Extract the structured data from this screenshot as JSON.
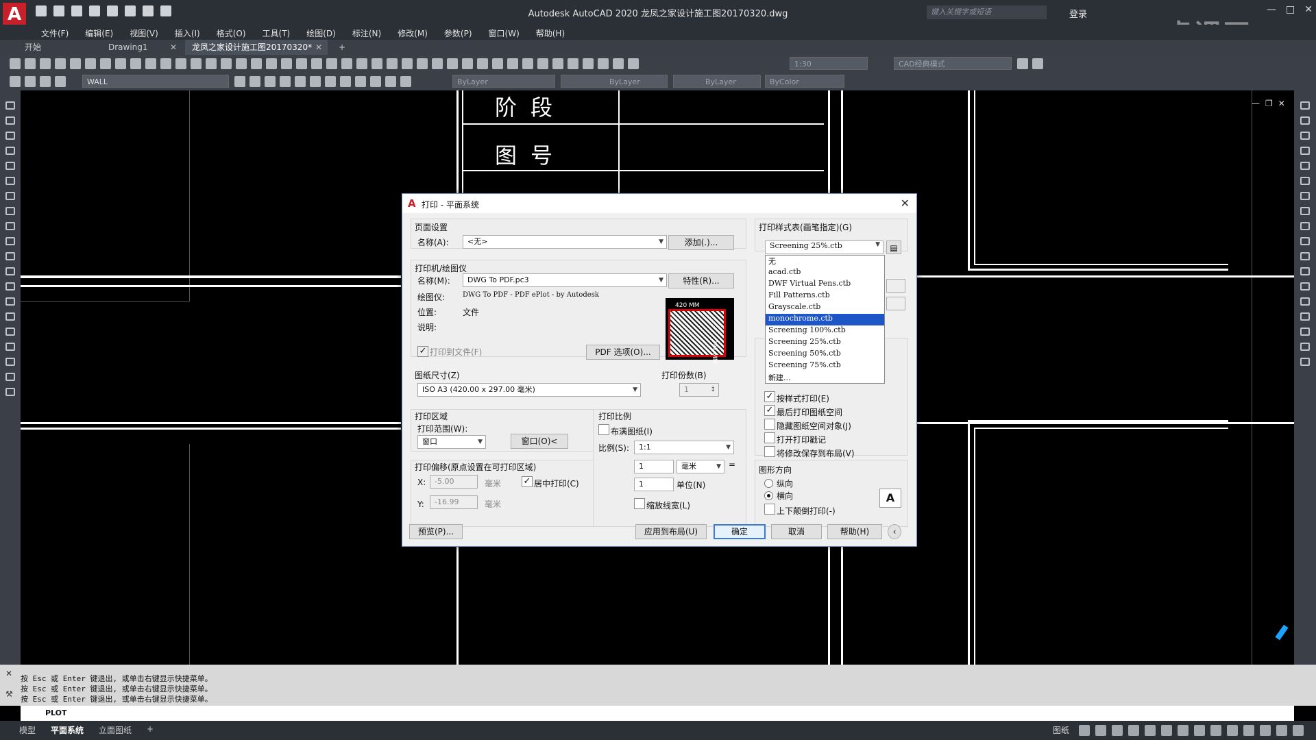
{
  "app": {
    "window_title": "Autodesk AutoCAD 2020    龙凤之家设计施工图20170320.dwg",
    "logo_letter": "A",
    "search_placeholder": "键入关键字或短语",
    "login": "登录",
    "watermark": "虎课网"
  },
  "menu": [
    "文件(F)",
    "编辑(E)",
    "视图(V)",
    "插入(I)",
    "格式(O)",
    "工具(T)",
    "绘图(D)",
    "标注(N)",
    "修改(M)",
    "参数(P)",
    "窗口(W)",
    "帮助(H)"
  ],
  "doc_tabs": [
    {
      "label": "开始"
    },
    {
      "label": "Drawing1"
    },
    {
      "label": "龙凤之家设计施工图20170320*"
    }
  ],
  "toolbar": {
    "scale_combo": "1:30",
    "workspace_combo": "CAD经典模式",
    "layer_combo": "WALL",
    "color_combo": "ByLayer",
    "linetype_combo": "ByLayer",
    "lineweight_combo": "ByLayer",
    "plotstyle_combo": "ByColor"
  },
  "drawing": {
    "label_stage": "阶段",
    "label_drawing_no": "图号"
  },
  "dialog": {
    "title": "打印 - 平面系统",
    "page_setup": {
      "section": "页面设置",
      "name_label": "名称(A):",
      "name_value": "<无>",
      "add_button": "添加(.)..."
    },
    "printer": {
      "section": "打印机/绘图仪",
      "name_label": "名称(M):",
      "name_value": "DWG To PDF.pc3",
      "properties_button": "特性(R)...",
      "plotter_label": "绘图仪:",
      "plotter_value": "DWG To PDF - PDF ePlot - by Autodesk",
      "location_label": "位置:",
      "location_value": "文件",
      "description_label": "说明:",
      "plot_to_file": "打印到文件(F)",
      "pdf_options_button": "PDF 选项(O)...",
      "preview_width": "420 MM",
      "preview_height": "297 MM"
    },
    "paper_size": {
      "section": "图纸尺寸(Z)",
      "value": "ISO A3 (420.00 x 297.00 毫米)"
    },
    "copies": {
      "section": "打印份数(B)",
      "value": "1"
    },
    "plot_area": {
      "section": "打印区域",
      "range_label": "打印范围(W):",
      "range_value": "窗口",
      "window_button": "窗口(O)<"
    },
    "plot_offset": {
      "section": "打印偏移(原点设置在可打印区域)",
      "x_label": "X:",
      "x_value": "-5.00",
      "x_unit": "毫米",
      "y_label": "Y:",
      "y_value": "-16.99",
      "y_unit": "毫米",
      "center_plot": "居中打印(C)"
    },
    "plot_scale": {
      "section": "打印比例",
      "fit_paper": "布满图纸(I)",
      "scale_label": "比例(S):",
      "scale_value": "1:1",
      "value1": "1",
      "unit1": "毫米",
      "value2": "1",
      "unit2": "单位(N)",
      "scale_lineweights": "缩放线宽(L)",
      "equals": "="
    },
    "plot_style_table": {
      "section": "打印样式表(画笔指定)(G)",
      "value": "Screening 25%.ctb",
      "options": [
        "无",
        "acad.ctb",
        "DWF Virtual Pens.ctb",
        "Fill Patterns.ctb",
        "Grayscale.ctb",
        "monochrome.ctb",
        "Screening 100%.ctb",
        "Screening 25%.ctb",
        "Screening 50%.ctb",
        "Screening 75%.ctb",
        "新建..."
      ],
      "highlighted": "monochrome.ctb"
    },
    "plot_options": {
      "plot_with_styles": "按样式打印(E)",
      "plot_paperspace_last": "最后打印图纸空间",
      "hide_paperspace_objects": "隐藏图纸空间对象(J)",
      "plot_stamp": "打开打印戳记",
      "save_changes": "将修改保存到布局(V)"
    },
    "orientation": {
      "section": "图形方向",
      "portrait": "纵向",
      "landscape": "横向",
      "upside_down": "上下颠倒打印(-)",
      "icon_letter": "A"
    },
    "buttons": {
      "preview": "预览(P)...",
      "apply_layout": "应用到布局(U)",
      "ok": "确定",
      "cancel": "取消",
      "help": "帮助(H)"
    }
  },
  "command": {
    "history": [
      "按 Esc 或 Enter 键退出, 或单击右键显示快捷菜单。",
      "按 Esc 或 Enter 键退出, 或单击右键显示快捷菜单。",
      "按 Esc 或 Enter 键退出, 或单击右键显示快捷菜单。"
    ],
    "current": "PLOT"
  },
  "status": {
    "layout_tabs": [
      "模型",
      "平面系统",
      "立面图纸"
    ],
    "add_tab": "+",
    "model_label": "图纸"
  }
}
